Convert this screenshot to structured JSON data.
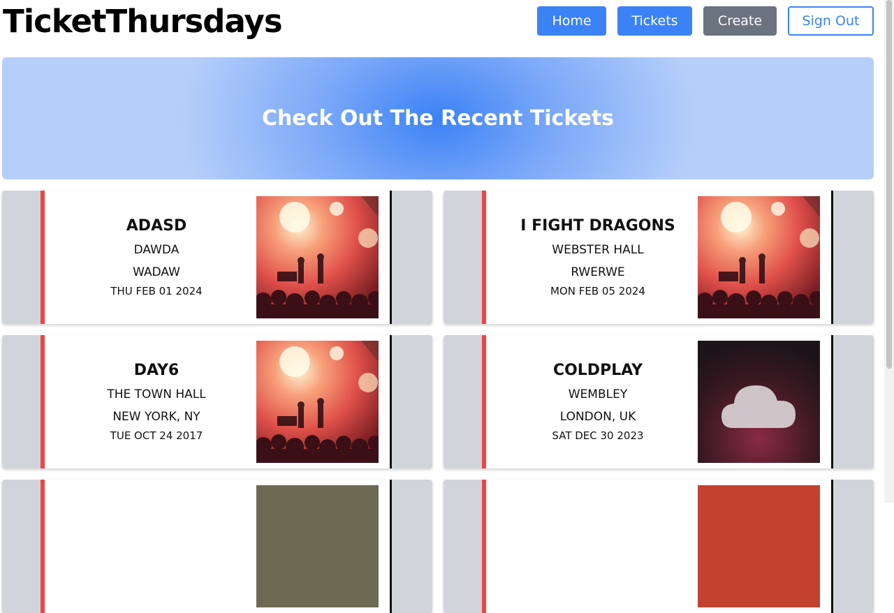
{
  "app": {
    "brand": "TicketThursdays"
  },
  "nav": {
    "home": "Home",
    "tickets": "Tickets",
    "create": "Create",
    "sign_out": "Sign Out"
  },
  "hero": {
    "title": "Check Out The Recent Tickets"
  },
  "tickets": [
    {
      "name": "ADASD",
      "venue": "DAWDA",
      "city": "WADAW",
      "date": "THU FEB 01 2024",
      "image": "concert-photo"
    },
    {
      "name": "I FIGHT DRAGONS",
      "venue": "WEBSTER HALL",
      "city": "RWERWE",
      "date": "MON FEB 05 2024",
      "image": "concert-photo"
    },
    {
      "name": "DAY6",
      "venue": "THE TOWN HALL",
      "city": "NEW YORK, NY",
      "date": "TUE OCT 24 2017",
      "image": "concert-photo"
    },
    {
      "name": "COLDPLAY",
      "venue": "WEMBLEY",
      "city": "LONDON, UK",
      "date": "SAT DEC 30 2023",
      "image": "cloud-artwork"
    }
  ],
  "colors": {
    "primary": "#3b82f6",
    "secondary": "#6b7280",
    "ticket_stub": "#d1d5db",
    "ticket_accent": "#ef4444"
  }
}
